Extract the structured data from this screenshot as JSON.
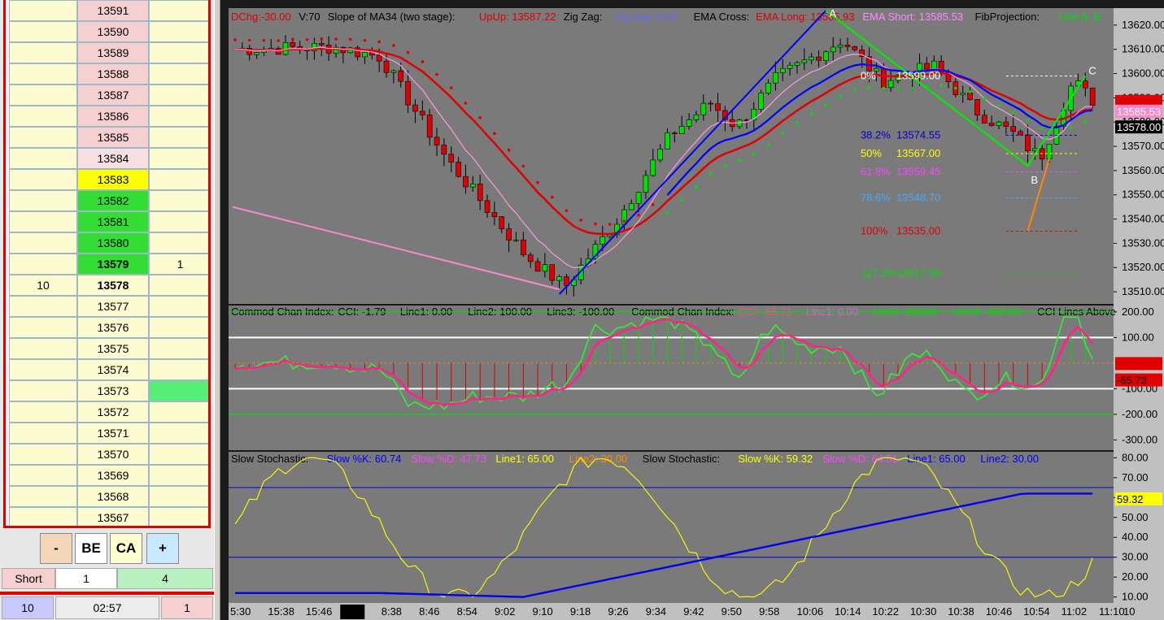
{
  "ladder": {
    "rows": [
      {
        "left": "",
        "price": "13591",
        "right": "",
        "price_bg": "#f6d0d0",
        "right_bg": "#fdfcd0",
        "bold": false
      },
      {
        "left": "",
        "price": "13590",
        "right": "",
        "price_bg": "#f6d0d0",
        "right_bg": "#fdfcd0",
        "bold": false
      },
      {
        "left": "",
        "price": "13589",
        "right": "",
        "price_bg": "#f6d0d0",
        "right_bg": "#fdfcd0",
        "bold": false
      },
      {
        "left": "",
        "price": "13588",
        "right": "",
        "price_bg": "#f6d0d0",
        "right_bg": "#fdfcd0",
        "bold": false
      },
      {
        "left": "",
        "price": "13587",
        "right": "",
        "price_bg": "#f6d0d0",
        "right_bg": "#fdfcd0",
        "bold": false
      },
      {
        "left": "",
        "price": "13586",
        "right": "",
        "price_bg": "#f6d0d0",
        "right_bg": "#fdfcd0",
        "bold": false
      },
      {
        "left": "",
        "price": "13585",
        "right": "",
        "price_bg": "#f6d0d0",
        "right_bg": "#fdfcd0",
        "bold": false
      },
      {
        "left": "",
        "price": "13584",
        "right": "",
        "price_bg": "#f8e0e0",
        "right_bg": "#fdfcd0",
        "bold": false
      },
      {
        "left": "",
        "price": "13583",
        "right": "",
        "price_bg": "#ffff00",
        "right_bg": "#fdfcd0",
        "bold": false
      },
      {
        "left": "",
        "price": "13582",
        "right": "",
        "price_bg": "#33dd33",
        "right_bg": "#fdfcd0",
        "bold": false
      },
      {
        "left": "",
        "price": "13581",
        "right": "",
        "price_bg": "#33dd33",
        "right_bg": "#fdfcd0",
        "bold": false
      },
      {
        "left": "",
        "price": "13580",
        "right": "",
        "price_bg": "#33dd33",
        "right_bg": "#fdfcd0",
        "bold": false
      },
      {
        "left": "",
        "price": "13579",
        "right": "1",
        "price_bg": "#33dd33",
        "right_bg": "#fdfcd0",
        "bold": true
      },
      {
        "left": "10",
        "price": "13578",
        "right": "",
        "price_bg": "#fdfcd0",
        "right_bg": "#fdfcd0",
        "bold": true
      },
      {
        "left": "",
        "price": "13577",
        "right": "",
        "price_bg": "#fdfcd0",
        "right_bg": "#fdfcd0",
        "bold": false
      },
      {
        "left": "",
        "price": "13576",
        "right": "",
        "price_bg": "#fdfcd0",
        "right_bg": "#fdfcd0",
        "bold": false
      },
      {
        "left": "",
        "price": "13575",
        "right": "",
        "price_bg": "#fdfcd0",
        "right_bg": "#fdfcd0",
        "bold": false
      },
      {
        "left": "",
        "price": "13574",
        "right": "",
        "price_bg": "#fdfcd0",
        "right_bg": "#fdfcd0",
        "bold": false
      },
      {
        "left": "",
        "price": "13573",
        "right": "",
        "price_bg": "#fdfcd0",
        "right_bg": "#55ee77",
        "bold": false
      },
      {
        "left": "",
        "price": "13572",
        "right": "",
        "price_bg": "#fdfcd0",
        "right_bg": "#fdfcd0",
        "bold": false
      },
      {
        "left": "",
        "price": "13571",
        "right": "",
        "price_bg": "#fdfcd0",
        "right_bg": "#fdfcd0",
        "bold": false
      },
      {
        "left": "",
        "price": "13570",
        "right": "",
        "price_bg": "#fdfcd0",
        "right_bg": "#fdfcd0",
        "bold": false
      },
      {
        "left": "",
        "price": "13569",
        "right": "",
        "price_bg": "#fdfcd0",
        "right_bg": "#fdfcd0",
        "bold": false
      },
      {
        "left": "",
        "price": "13568",
        "right": "",
        "price_bg": "#fdfcd0",
        "right_bg": "#fdfcd0",
        "bold": false
      },
      {
        "left": "",
        "price": "13567",
        "right": "",
        "price_bg": "#fdfcd0",
        "right_bg": "#fdfcd0",
        "bold": false
      }
    ]
  },
  "buttons": {
    "minus": "-",
    "be": "BE",
    "ca": "CA",
    "plus": "+"
  },
  "order": {
    "side": "Short",
    "qty": "1",
    "pending": "4"
  },
  "position": {
    "left": "10",
    "time": "02:57",
    "right": "1"
  },
  "colors": {
    "bg": "#7a7a7a",
    "up": "#00e000",
    "down": "#e00000",
    "ema_long": "#e00000",
    "ema_short": "#ff88ff",
    "blue": "#0000ff",
    "accent_red": "#e00000"
  },
  "price_panel": {
    "header": [
      {
        "t": "DChg:-30.00",
        "c": "#e00000"
      },
      {
        "t": "V:70",
        "c": "#000000"
      },
      {
        "t": "Slope of MA34 (two stage):",
        "c": "#000000"
      },
      {
        "t": "UpUp: 13587.22",
        "c": "#e00000"
      },
      {
        "t": "Zig Zag:",
        "c": "#000000"
      },
      {
        "t": "Zig Zag: 0.00",
        "c": "#6666ff"
      },
      {
        "t": "EMA Cross:",
        "c": "#000000"
      },
      {
        "t": "EMA Long: 13585.93",
        "c": "#e00000"
      },
      {
        "t": "EMA Short: 13585.53",
        "c": "#ff88ff"
      },
      {
        "t": "FibProjection:",
        "c": "#000000"
      },
      {
        "t": "Use A, B",
        "c": "#00dd00"
      }
    ],
    "y_ticks": [
      "13620.00",
      "13610.00",
      "13600.00",
      "13590.00",
      "13580.00",
      "13570.00",
      "13560.00",
      "13550.00",
      "13540.00",
      "13530.00",
      "13520.00",
      "13510.00"
    ],
    "ylim": [
      13505,
      13627
    ],
    "last_label": "13578.00",
    "ema_short_label": "13585.53",
    "ema_long_label": "13587.22",
    "points": {
      "A": "A",
      "B": "B",
      "C": "C"
    },
    "fibs": [
      {
        "pct": "0%",
        "val": "13599.00",
        "c": "#ffffff",
        "price": 13599
      },
      {
        "pct": "38.2%",
        "val": "13574.55",
        "c": "#0000cc",
        "price": 13574.55
      },
      {
        "pct": "50%",
        "val": "13567.00",
        "c": "#ffff00",
        "price": 13567
      },
      {
        "pct": "61.8%",
        "val": "13559.45",
        "c": "#ff44ff",
        "price": 13559.45
      },
      {
        "pct": "78.6%",
        "val": "13548.70",
        "c": "#44aaff",
        "price": 13548.7
      },
      {
        "pct": "100%",
        "val": "13535.00",
        "c": "#e00000",
        "price": 13535
      },
      {
        "pct": "127.2%",
        "val": "13517.59",
        "c": "#00dd00",
        "price": 13517.59
      }
    ]
  },
  "cci_panel": {
    "header": [
      {
        "t": "Commod Chan Index:",
        "c": "#000000"
      },
      {
        "t": "CCI: -1.79",
        "c": "#000000"
      },
      {
        "t": "Line1: 0.00",
        "c": "#000000"
      },
      {
        "t": "Line2: 100.00",
        "c": "#000000"
      },
      {
        "t": "Line3: -100.00",
        "c": "#000000"
      },
      {
        "t": "Commod Chan Index:",
        "c": "#000000"
      },
      {
        "t": "CCI: -65.71",
        "c": "#ff44aa"
      },
      {
        "t": "Line1: 0.00",
        "c": "#ff44ff"
      },
      {
        "t": "Line2: 200.00",
        "c": "#00dd00"
      },
      {
        "t": "Line3: -200.00",
        "c": "#00dd00"
      },
      {
        "t": "CCI Lines Above",
        "c": "#000000"
      }
    ],
    "y_ticks": [
      "200.00",
      "100.00",
      "-100.00",
      "-200.00",
      "-300.00"
    ],
    "ylim": [
      -340,
      225
    ],
    "label_a": "-1.80",
    "label_b": "-65.73"
  },
  "stoch_panel": {
    "header": [
      {
        "t": "Slow Stochastic:",
        "c": "#000000"
      },
      {
        "t": "Slow %K: 60.74",
        "c": "#0000ff"
      },
      {
        "t": "Slow %D: 47.73",
        "c": "#ff44ff"
      },
      {
        "t": "Line1: 65.00",
        "c": "#ffff00"
      },
      {
        "t": "Line2: 30.00",
        "c": "#ff8800"
      },
      {
        "t": "Slow Stochastic:",
        "c": "#000000"
      },
      {
        "t": "Slow %K: 59.32",
        "c": "#ffff00"
      },
      {
        "t": "Slow %D: 64.51",
        "c": "#ff44ff"
      },
      {
        "t": "Line1: 65.00",
        "c": "#0000ff"
      },
      {
        "t": "Line2: 30.00",
        "c": "#0000ff"
      }
    ],
    "y_ticks": [
      "80.00",
      "70.00",
      "60.00",
      "50.00",
      "40.00",
      "30.00",
      "20.00",
      "10.00"
    ],
    "ylim": [
      7,
      83
    ],
    "last_label": "59.32"
  },
  "x_axis": {
    "labels": [
      "5:30",
      "15:38",
      "15:46",
      "6/21",
      "8:38",
      "8:46",
      "8:54",
      "9:02",
      "9:10",
      "9:18",
      "9:26",
      "9:34",
      "9:42",
      "9:50",
      "9:58",
      "10:06",
      "10:14",
      "10:22",
      "10:30",
      "10:38",
      "10:46",
      "10:54",
      "11:02",
      "11:10"
    ],
    "right": "10"
  }
}
